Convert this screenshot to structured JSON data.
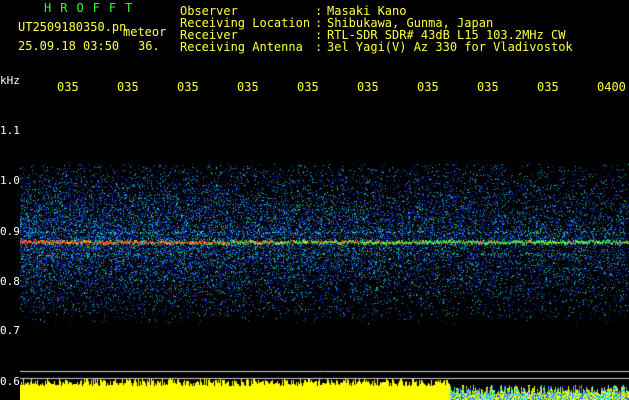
{
  "header": {
    "title": "HROFFT",
    "filename": "UT2509180350.pn",
    "meteor_label": "meteor",
    "timestamp": "25.09.18 03:50",
    "count": "36."
  },
  "info": [
    {
      "key": "Observer",
      "sep": ":",
      "value": "Masaki Kano"
    },
    {
      "key": "Receiving Location",
      "sep": ":",
      "value": "Shibukawa, Gunma, Japan"
    },
    {
      "key": "Receiver",
      "sep": ":",
      "value": "RTL-SDR SDR# 43dB L15 103.2MHz CW"
    },
    {
      "key": "Receiving Antenna",
      "sep": ":",
      "value": "3el Yagi(V) Az 330 for Vladivostok"
    }
  ],
  "y_axis": {
    "unit": "kHz",
    "ticks": [
      "1.1",
      "1.0",
      "0.9",
      "0.8",
      "0.7",
      "0.6"
    ]
  },
  "x_axis": {
    "ticks": [
      "035",
      "035",
      "035",
      "035",
      "035",
      "035",
      "035",
      "035",
      "035",
      "0400"
    ]
  },
  "colors": {
    "background": "#000000",
    "title": "#30ff30",
    "text": "#ffff40",
    "axis_text": "#ffffff",
    "signal_hot": "#ff3030",
    "signal_mid": "#30ff60",
    "noise": "#2050ff",
    "level_bar": "#ffff00"
  }
}
